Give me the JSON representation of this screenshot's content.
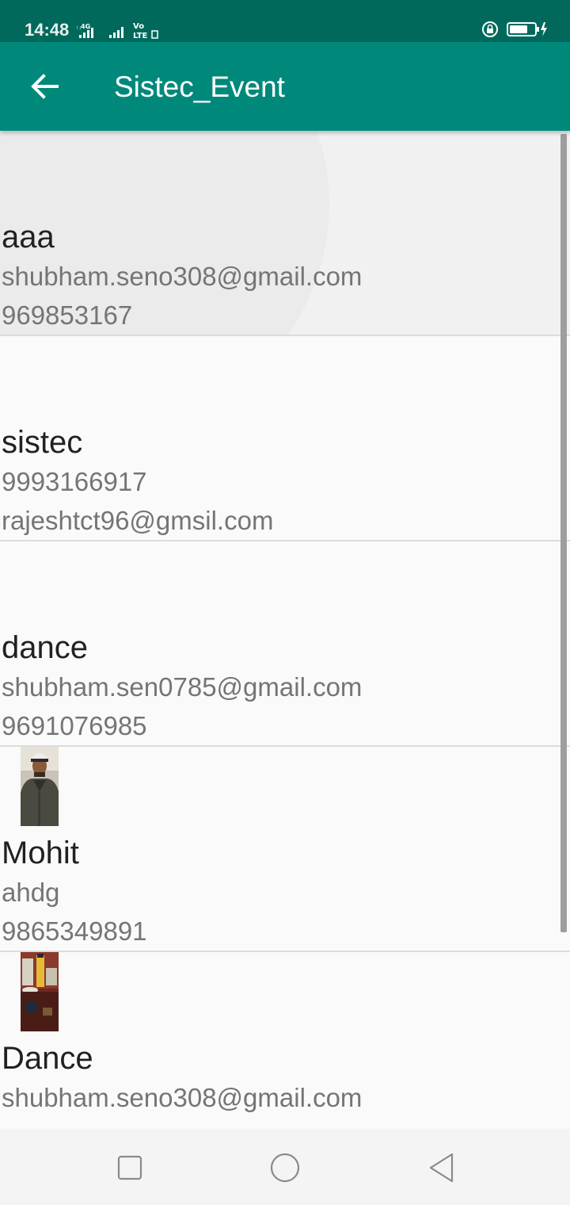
{
  "status_bar": {
    "time": "14:48",
    "network_label": "4G",
    "volte_label": "Vo LTE",
    "background": "#00695c"
  },
  "toolbar": {
    "title": "Sistec_Event",
    "background": "#00897b",
    "back_icon": "arrow-back-icon"
  },
  "events": [
    {
      "title": "aaa",
      "line1": "shubham.seno308@gmail.com",
      "line2": "969853167",
      "has_image": false
    },
    {
      "title": "sistec",
      "line1": "9993166917",
      "line2": "rajeshtct96@gmsil.com",
      "has_image": false
    },
    {
      "title": "dance",
      "line1": "shubham.sen0785@gmail.com",
      "line2": "9691076985",
      "has_image": false
    },
    {
      "title": "Mohit",
      "line1": "ahdg",
      "line2": "9865349891",
      "has_image": true,
      "image": "person-photo"
    },
    {
      "title": "Dance",
      "line1": "shubham.seno308@gmail.com",
      "line2": "",
      "has_image": true,
      "image": "room-photo"
    }
  ],
  "nav_bar": {
    "recent_icon": "square-icon",
    "home_icon": "circle-icon",
    "back_icon": "triangle-back-icon"
  }
}
